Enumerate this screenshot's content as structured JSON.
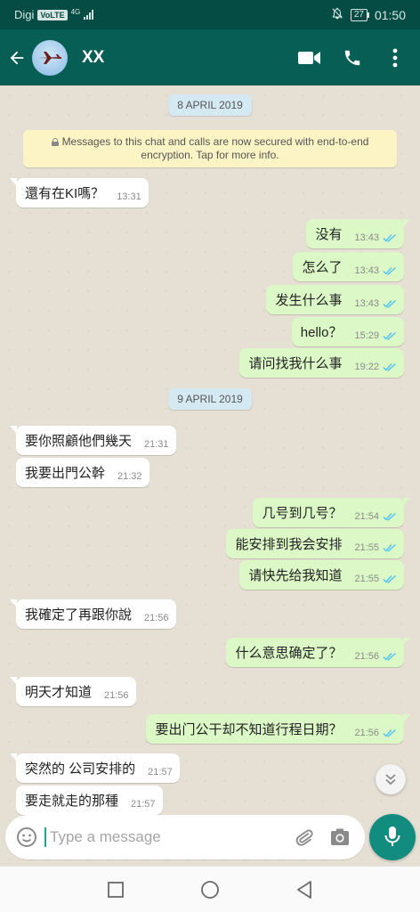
{
  "status_bar": {
    "carrier": "Digi",
    "volte": "VoLTE",
    "network": "4G",
    "battery": "27",
    "time": "01:50"
  },
  "header": {
    "contact_name": "XX"
  },
  "dates": {
    "first": "8 APRIL 2019",
    "second": "9 APRIL 2019"
  },
  "encryption_notice": "Messages to this chat and calls are now secured with end-to-end encryption. Tap for more info.",
  "messages": [
    {
      "dir": "in",
      "text": "還有在KI嗎？",
      "time": "13:31"
    },
    {
      "dir": "out",
      "text": "没有",
      "time": "13:43"
    },
    {
      "dir": "out",
      "text": "怎么了",
      "time": "13:43"
    },
    {
      "dir": "out",
      "text": "发生什么事",
      "time": "13:43"
    },
    {
      "dir": "out",
      "text": "hello？",
      "time": "15:29"
    },
    {
      "dir": "out",
      "text": "请问找我什么事",
      "time": "19:22"
    },
    {
      "dir": "in",
      "text": "要你照顧他們幾天",
      "time": "21:31"
    },
    {
      "dir": "in",
      "text": "我要出門公幹",
      "time": "21:32"
    },
    {
      "dir": "out",
      "text": "几号到几号？",
      "time": "21:54"
    },
    {
      "dir": "out",
      "text": "能安排到我会安排",
      "time": "21:55"
    },
    {
      "dir": "out",
      "text": "请快先给我知道",
      "time": "21:55"
    },
    {
      "dir": "in",
      "text": "我確定了再跟你說",
      "time": "21:56"
    },
    {
      "dir": "out",
      "text": "什么意思确定了？",
      "time": "21:56"
    },
    {
      "dir": "in",
      "text": "明天才知道",
      "time": "21:56"
    },
    {
      "dir": "out",
      "text": "要出门公干却不知道行程日期？",
      "time": "21:56"
    },
    {
      "dir": "in",
      "text": "突然的 公司安排的",
      "time": "21:57"
    },
    {
      "dir": "in",
      "text": "要走就走的那種",
      "time": "21:57"
    }
  ],
  "input": {
    "placeholder": "Type a message"
  },
  "colors": {
    "header": "#075e54",
    "outgoing_bubble": "#dcf8c6",
    "incoming_bubble": "#ffffff",
    "read_ticks": "#4fc3f7",
    "mic_button": "#128c7e"
  },
  "icons": {
    "header": [
      "back-arrow-icon",
      "video-call-icon",
      "voice-call-icon",
      "more-options-icon"
    ],
    "input": [
      "emoji-icon",
      "attach-icon",
      "camera-icon",
      "mic-icon"
    ],
    "nav": [
      "recent-apps-icon",
      "home-icon",
      "back-icon"
    ]
  }
}
